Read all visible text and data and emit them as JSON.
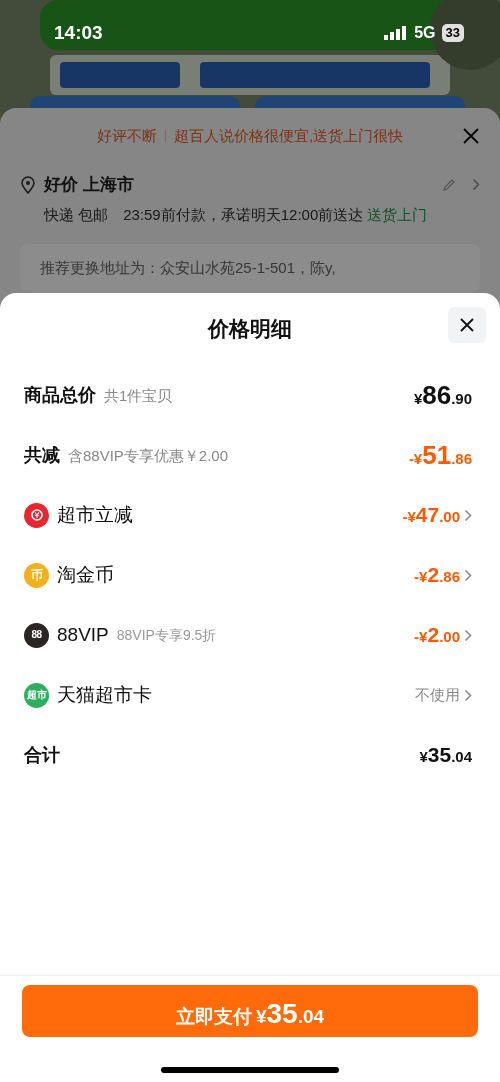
{
  "status_bar": {
    "time": "14:03",
    "network": "5G",
    "battery": "33"
  },
  "background": {
    "notice": {
      "tag": "好评不断",
      "text": "超百人说价格很便宜,送货上门很快"
    },
    "address": {
      "title": "好价 上海市",
      "delivery": "快递 包邮",
      "promise": "23:59前付款，承诺明天12:00前送达",
      "highlight": "送货上门"
    },
    "suggestion": "推荐更换地址为：众安山水苑25-1-501，陈y,"
  },
  "sheet": {
    "title": "价格明细",
    "rows": [
      {
        "kind": "header",
        "label": "商品总价",
        "note": "共1件宝贝",
        "amount": {
          "sign": "¥",
          "int": "86",
          "frac": ".90"
        }
      },
      {
        "kind": "header",
        "label": "共减",
        "note": "含88VIP专享优惠￥2.00",
        "amount": {
          "sign": "-¥",
          "int": "51",
          "frac": ".86"
        },
        "accent": true
      },
      {
        "kind": "item",
        "label": "超市立减",
        "color": "#e8262d",
        "amount": {
          "sign": "-¥",
          "int": "47",
          "frac": ".00"
        }
      },
      {
        "kind": "item",
        "label": "淘金币",
        "color": "#f2b01e",
        "badge": "币",
        "amount": {
          "sign": "-¥",
          "int": "2",
          "frac": ".86"
        }
      },
      {
        "kind": "item",
        "label": "88VIP",
        "color": "#2b2523",
        "badge": "88",
        "note": "88VIP专享9.5折",
        "amount": {
          "sign": "-¥",
          "int": "2",
          "frac": ".00"
        }
      },
      {
        "kind": "option",
        "label": "天猫超市卡",
        "color": "#2fae5f",
        "badge": "超市",
        "value": "不使用"
      },
      {
        "kind": "total",
        "label": "合计",
        "amount": {
          "sign": "¥",
          "int": "35",
          "frac": ".04"
        }
      }
    ],
    "pay_button": {
      "label": "立即支付",
      "amount": {
        "sign": "¥",
        "int": "35",
        "frac": ".04"
      }
    }
  }
}
